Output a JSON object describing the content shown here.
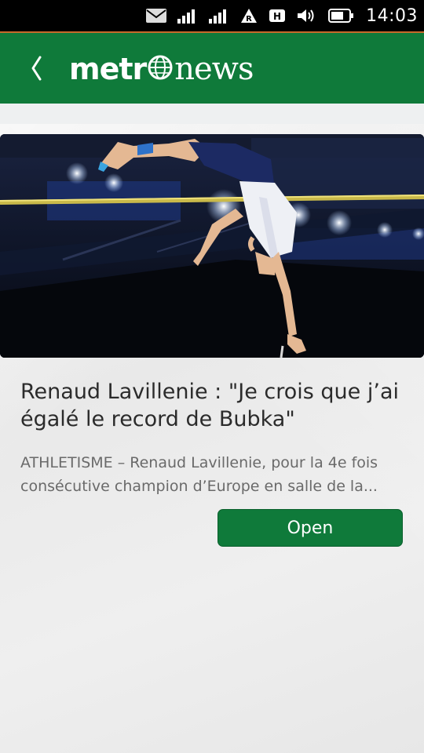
{
  "status_bar": {
    "time": "14:03",
    "icons": [
      "mail-icon",
      "signal-icon",
      "signal-icon",
      "roaming-icon",
      "hspa-icon",
      "volume-icon",
      "battery-icon"
    ],
    "roaming_label": "R",
    "network_label": "H"
  },
  "header": {
    "brand_part1": "metr",
    "brand_part2": "news",
    "back_icon": "chevron-left-icon",
    "color": "#0f7a3a"
  },
  "article": {
    "image_alt": "Pole vaulter clearing the bar",
    "title": "Renaud Lavillenie : \"Je crois que j’ai égalé le record de Bubka\"",
    "summary": "ATHLETISME – Renaud Lavillenie, pour la 4e fois consécutive champion d’Europe en salle de la...",
    "open_label": "Open"
  }
}
